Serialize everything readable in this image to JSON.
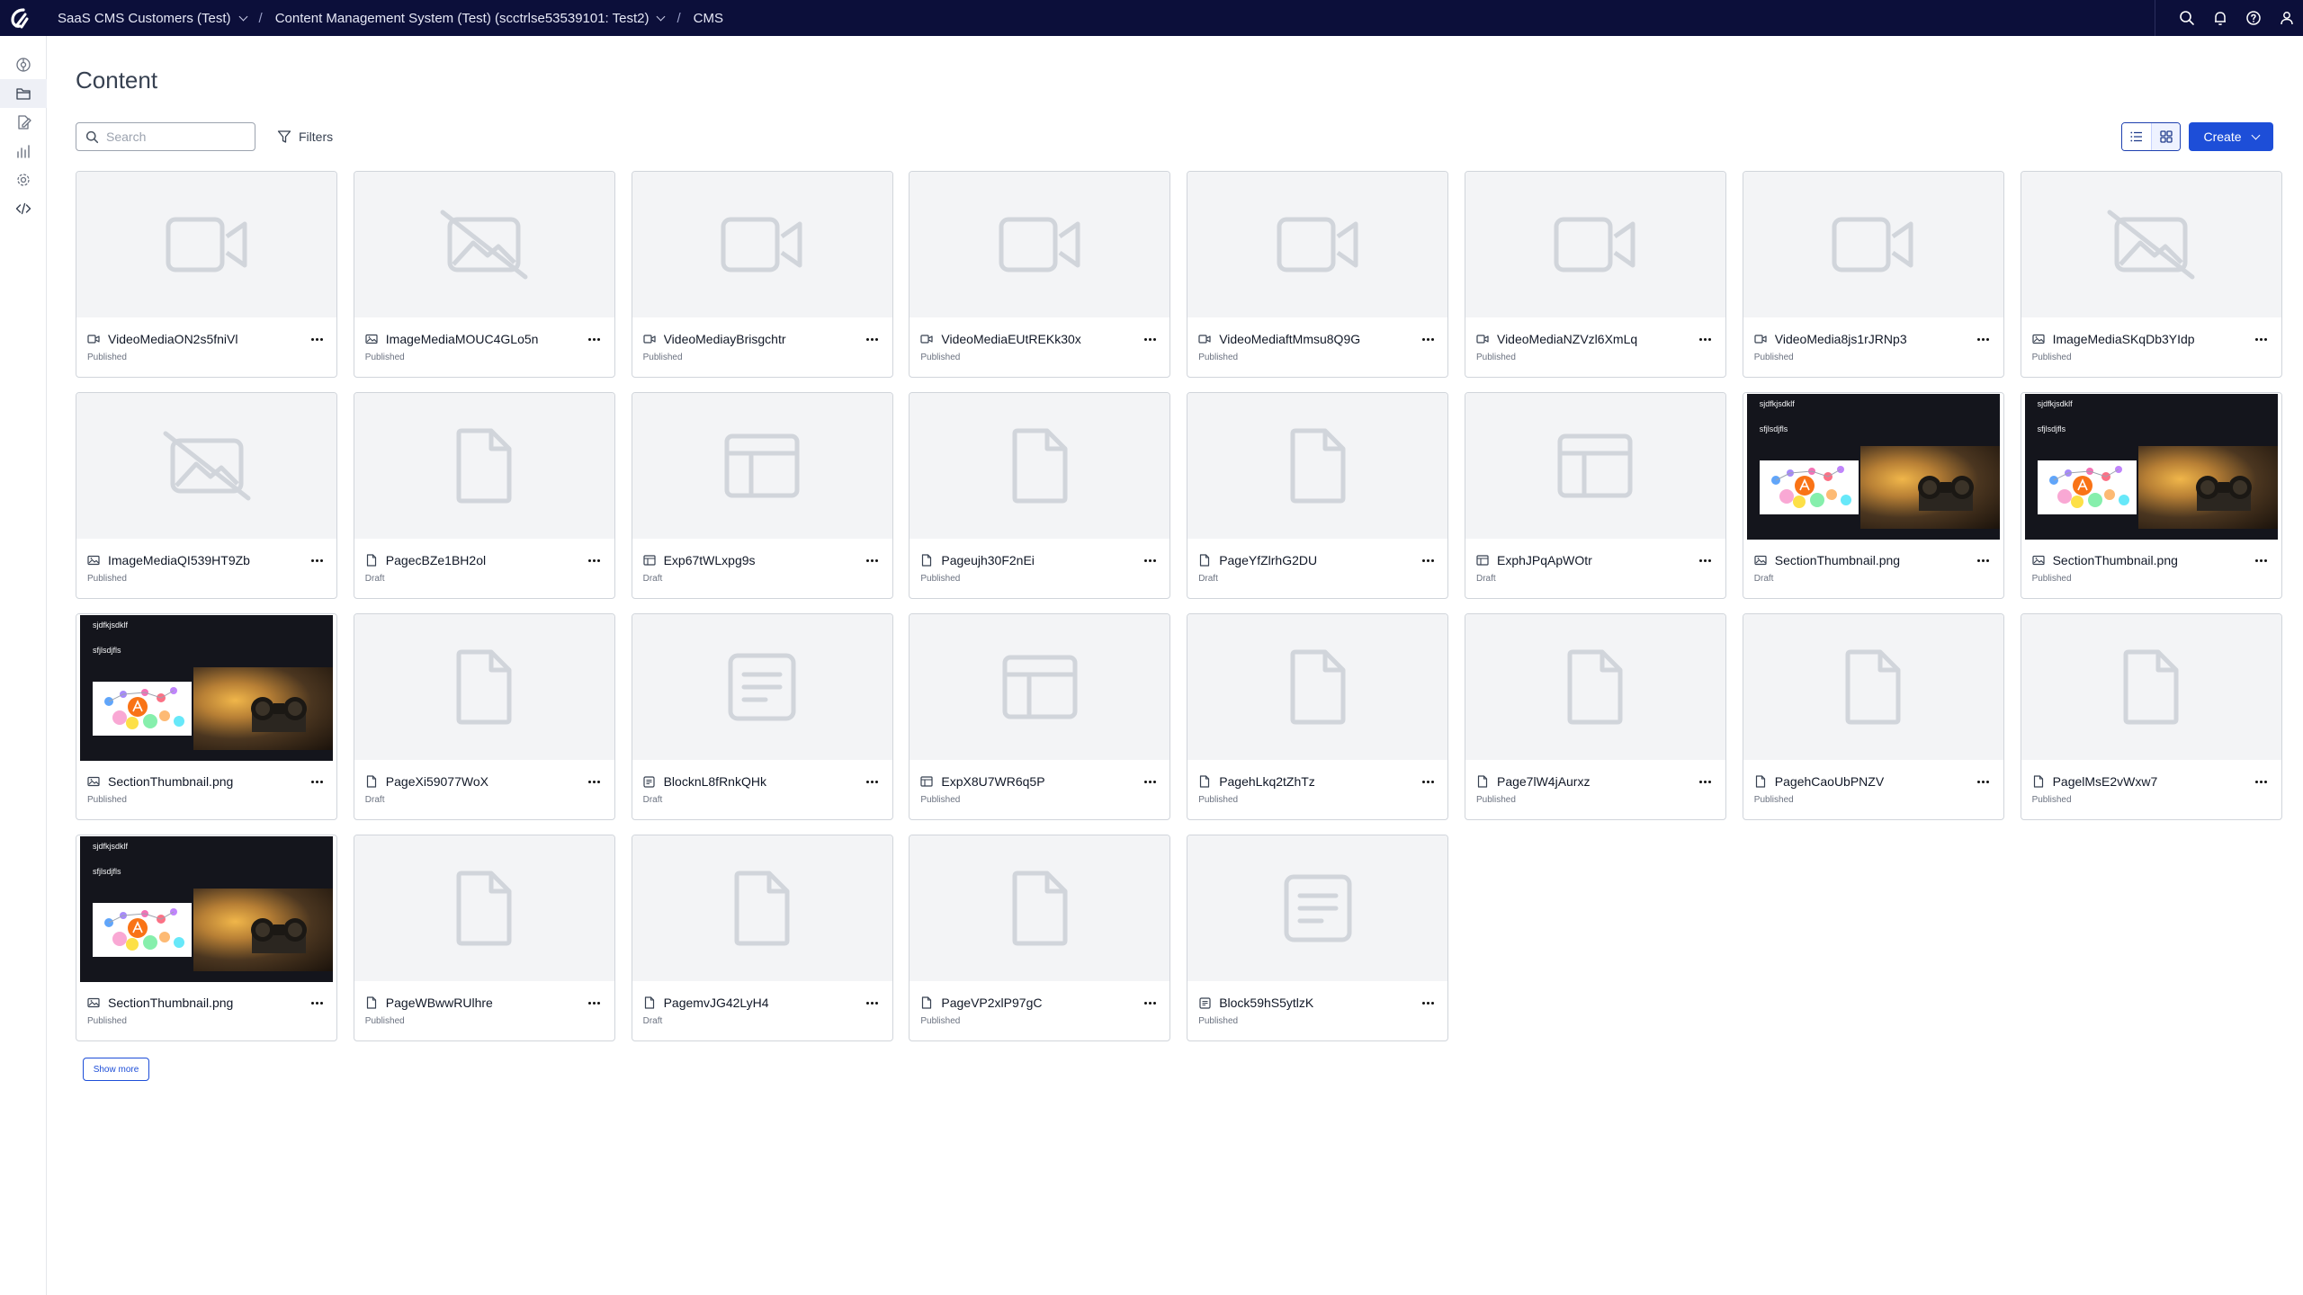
{
  "topbar": {
    "logo_icon": "optimizely-logo",
    "breadcrumbs": [
      {
        "label": "SaaS CMS Customers (Test)",
        "dropdown": true
      },
      {
        "label": "Content Management System (Test) (scctrlse53539101: Test2)",
        "dropdown": true
      },
      {
        "label": "CMS",
        "dropdown": false
      }
    ],
    "right_icons": [
      "search-icon",
      "bell-icon",
      "help-icon",
      "user-icon"
    ]
  },
  "rail": {
    "items": [
      {
        "icon": "overview-icon",
        "active": false
      },
      {
        "icon": "folder-icon",
        "active": true
      },
      {
        "icon": "edit-document-icon",
        "active": false
      },
      {
        "icon": "analytics-icon",
        "active": false
      },
      {
        "icon": "settings-icon",
        "active": false
      },
      {
        "icon": "code-icon",
        "active": false
      }
    ]
  },
  "page": {
    "title": "Content",
    "search_placeholder": "Search",
    "filters_label": "Filters",
    "create_label": "Create",
    "show_more_label": "Show more"
  },
  "colors": {
    "topbar": "#0c0f3a",
    "primary": "#1d4ed8"
  },
  "items": [
    {
      "name": "VideoMediaON2s5fniVl",
      "status": "Published",
      "type": "video"
    },
    {
      "name": "ImageMediaMOUC4GLo5n",
      "status": "Published",
      "type": "image-missing"
    },
    {
      "name": "VideoMediayBrisgchtr",
      "status": "Published",
      "type": "video"
    },
    {
      "name": "VideoMediaEUtREKk30x",
      "status": "Published",
      "type": "video"
    },
    {
      "name": "VideoMediaftMmsu8Q9G",
      "status": "Published",
      "type": "video"
    },
    {
      "name": "VideoMediaNZVzl6XmLq",
      "status": "Published",
      "type": "video"
    },
    {
      "name": "VideoMedia8js1rJRNp3",
      "status": "Published",
      "type": "video"
    },
    {
      "name": "ImageMediaSKqDb3YIdp",
      "status": "Published",
      "type": "image-missing"
    },
    {
      "name": "ImageMediaQI539HT9Zb",
      "status": "Published",
      "type": "image-missing"
    },
    {
      "name": "PagecBZe1BH2ol",
      "status": "Draft",
      "type": "page"
    },
    {
      "name": "Exp67tWLxpg9s",
      "status": "Draft",
      "type": "experience"
    },
    {
      "name": "Pageujh30F2nEi",
      "status": "Published",
      "type": "page"
    },
    {
      "name": "PageYfZlrhG2DU",
      "status": "Draft",
      "type": "page"
    },
    {
      "name": "ExphJPqApWOtr",
      "status": "Draft",
      "type": "experience"
    },
    {
      "name": "SectionThumbnail.png",
      "status": "Draft",
      "type": "image"
    },
    {
      "name": "SectionThumbnail.png",
      "status": "Published",
      "type": "image"
    },
    {
      "name": "SectionThumbnail.png",
      "status": "Published",
      "type": "image"
    },
    {
      "name": "PageXi59077WoX",
      "status": "Draft",
      "type": "page"
    },
    {
      "name": "BlocknL8fRnkQHk",
      "status": "Draft",
      "type": "block"
    },
    {
      "name": "ExpX8U7WR6q5P",
      "status": "Published",
      "type": "experience"
    },
    {
      "name": "PagehLkq2tZhTz",
      "status": "Published",
      "type": "page"
    },
    {
      "name": "Page7lW4jAurxz",
      "status": "Published",
      "type": "page"
    },
    {
      "name": "PagehCaoUbPNZV",
      "status": "Published",
      "type": "page"
    },
    {
      "name": "PagelMsE2vWxw7",
      "status": "Published",
      "type": "page"
    },
    {
      "name": "SectionThumbnail.png",
      "status": "Published",
      "type": "image"
    },
    {
      "name": "PageWBwwRUlhre",
      "status": "Published",
      "type": "page"
    },
    {
      "name": "PagemvJG42LyH4",
      "status": "Draft",
      "type": "page"
    },
    {
      "name": "PageVP2xlP97gC",
      "status": "Published",
      "type": "page"
    },
    {
      "name": "Block59hS5ytlzK",
      "status": "Published",
      "type": "block"
    }
  ],
  "thumbnail_text": {
    "line1": "sjdfkjsdklf",
    "line2": "sfjlsdjfls"
  }
}
